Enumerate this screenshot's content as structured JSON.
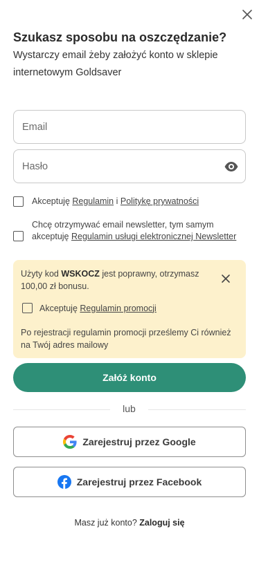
{
  "header": {
    "title": "Szukasz sposobu na oszczędzanie?",
    "subtitle": "Wystarczy email żeby założyć konto w sklepie internetowym Goldsaver"
  },
  "form": {
    "email_placeholder": "Email",
    "password_placeholder": "Hasło"
  },
  "terms": {
    "prefix": "Akceptuję ",
    "regulamin_link": "Regulamin",
    "and": " i ",
    "privacy_link": "Politykę prywatności",
    "checked": false
  },
  "newsletter": {
    "text": "Chcę otrzymywać email newsletter, tym samym akceptuję ",
    "link": "Regulamin usługi elektronicznej Newsletter",
    "checked": false
  },
  "promo": {
    "msg_prefix": "Użyty kod ",
    "code": "WSKOCZ",
    "msg_suffix": " jest poprawny, otrzymasz 100,00 zł bonusu.",
    "check_prefix": "Akceptuję ",
    "check_link": "Regulamin promocji",
    "note": "Po rejestracji regulamin promocji prześlemy Ci również na Twój adres mailowy",
    "background": "#fdf1cc",
    "checked": false
  },
  "actions": {
    "primary_label": "Załóż konto",
    "primary_color": "#2e8f77",
    "or_label": "lub",
    "google_label": "Zarejestruj przez Google",
    "google_icon": "google-icon",
    "facebook_label": "Zarejestruj przez Facebook",
    "facebook_icon": "facebook-icon"
  },
  "footer": {
    "question": "Masz już konto? ",
    "login_link": "Zaloguj się"
  }
}
